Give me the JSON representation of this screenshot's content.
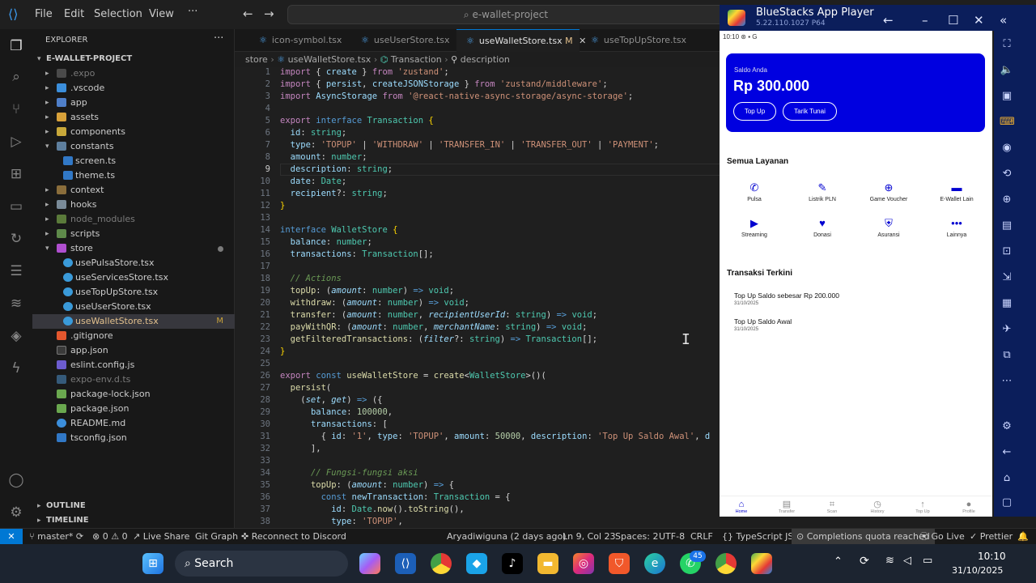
{
  "titlebar": {
    "menu": [
      "File",
      "Edit",
      "Selection",
      "View"
    ],
    "search_text": "e-wallet-project"
  },
  "explorer": {
    "title": "EXPLORER",
    "project": "E-WALLET-PROJECT",
    "items": [
      {
        "label": ".expo"
      },
      {
        "label": ".vscode"
      },
      {
        "label": "app"
      },
      {
        "label": "assets"
      },
      {
        "label": "components"
      },
      {
        "label": "constants"
      },
      {
        "label": "screen.ts"
      },
      {
        "label": "theme.ts"
      },
      {
        "label": "context"
      },
      {
        "label": "hooks"
      },
      {
        "label": "node_modules"
      },
      {
        "label": "scripts"
      },
      {
        "label": "store"
      },
      {
        "label": "usePulsaStore.tsx"
      },
      {
        "label": "useServicesStore.tsx"
      },
      {
        "label": "useTopUpStore.tsx"
      },
      {
        "label": "useUserStore.tsx"
      },
      {
        "label": "useWalletStore.tsx",
        "badge": "M"
      },
      {
        "label": ".gitignore"
      },
      {
        "label": "app.json"
      },
      {
        "label": "eslint.config.js"
      },
      {
        "label": "expo-env.d.ts"
      },
      {
        "label": "package-lock.json"
      },
      {
        "label": "package.json"
      },
      {
        "label": "README.md"
      },
      {
        "label": "tsconfig.json"
      }
    ],
    "outline": "OUTLINE",
    "timeline": "TIMELINE"
  },
  "tabs": [
    {
      "label": "icon-symbol.tsx"
    },
    {
      "label": "useUserStore.tsx"
    },
    {
      "label": "useWalletStore.tsx",
      "badge": "M"
    },
    {
      "label": "useTopUpStore.tsx"
    }
  ],
  "breadcrumb": [
    "store",
    "useWalletStore.tsx",
    "Transaction",
    "description"
  ],
  "editor": {
    "line_numbers": [
      "1",
      "2",
      "3",
      "4",
      "5",
      "6",
      "7",
      "8",
      "9",
      "10",
      "11",
      "12",
      "13",
      "14",
      "15",
      "16",
      "17",
      "18",
      "19",
      "20",
      "21",
      "22",
      "23",
      "24",
      "25",
      "26",
      "27",
      "28",
      "29",
      "30",
      "31",
      "32",
      "33",
      "34",
      "35",
      "36",
      "37",
      "38"
    ]
  },
  "statusbar": {
    "branch": "master*",
    "problems": "0 ⚠ 0",
    "live_share": "Live Share",
    "git_graph": "Git Graph",
    "discord": "Reconnect to Discord",
    "blame": "Aryadiwiguna (2 days ago)",
    "position": "Ln 9, Col 23",
    "spaces": "Spaces: 2",
    "encoding": "UTF-8",
    "eol": "CRLF",
    "language": "TypeScript JSX",
    "completions": "Completions quota reached",
    "go_live": "Go Live",
    "prettier": "Prettier"
  },
  "bluestacks": {
    "title": "BlueStacks App Player",
    "version": "5.22.110.1027  P64"
  },
  "phone": {
    "status_time": "10:10",
    "saldo_label": "Saldo Anda",
    "saldo_value": "Rp 300.000",
    "btn_topup": "Top Up",
    "btn_tarik": "Tarik Tunai",
    "layanan_title": "Semua Layanan",
    "services": [
      {
        "label": "Pulsa",
        "icon": "phone-icon"
      },
      {
        "label": "Listrik PLN",
        "icon": "lightning-icon"
      },
      {
        "label": "Game Voucher",
        "icon": "gamepad-icon"
      },
      {
        "label": "E-Wallet Lain",
        "icon": "wallet-icon"
      },
      {
        "label": "Streaming",
        "icon": "play-icon"
      },
      {
        "label": "Donasi",
        "icon": "heart-icon"
      },
      {
        "label": "Asuransi",
        "icon": "shield-icon"
      },
      {
        "label": "Lainnya",
        "icon": "more-icon"
      }
    ],
    "trx_title": "Transaksi Terkini",
    "transactions": [
      {
        "desc": "Top Up Saldo sebesar Rp 200.000",
        "date": "31/10/2025"
      },
      {
        "desc": "Top Up Saldo Awal",
        "date": "31/10/2025"
      }
    ],
    "nav": [
      "Home",
      "Transfer",
      "Scan",
      "History",
      "Top Up",
      "Profile"
    ]
  },
  "taskbar": {
    "search": "Search",
    "time": "10:10",
    "date": "31/10/2025",
    "whatsapp_badge": "45"
  }
}
